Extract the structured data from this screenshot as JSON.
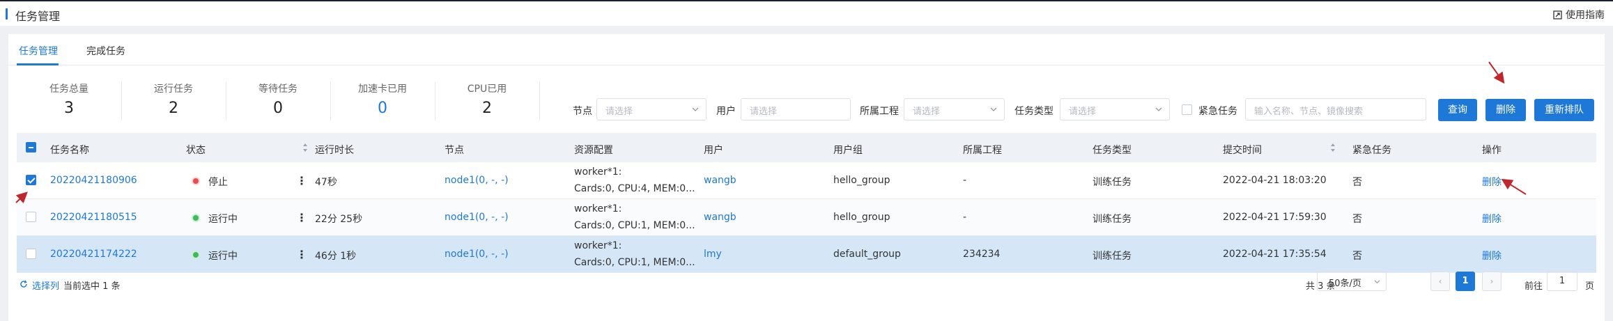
{
  "header": {
    "title": "任务管理",
    "guide_label": "使用指南",
    "guide_icon": "guide-icon"
  },
  "tabs": [
    {
      "label": "任务管理",
      "active": true
    },
    {
      "label": "完成任务",
      "active": false
    }
  ],
  "stats": [
    {
      "label": "任务总量",
      "value": "3"
    },
    {
      "label": "运行任务",
      "value": "2"
    },
    {
      "label": "等待任务",
      "value": "0"
    },
    {
      "label": "加速卡已用",
      "value": "0"
    },
    {
      "label": "CPU已用",
      "value": "2"
    }
  ],
  "filters": {
    "node_label": "节点",
    "node_placeholder": "请选择",
    "user_label": "用户",
    "user_placeholder": "请选择",
    "project_label": "所属工程",
    "project_placeholder": "请选择",
    "type_label": "任务类型",
    "type_placeholder": "请选择",
    "urgent_label": "紧急任务",
    "search_placeholder": "输入名称、节点、镜像搜索"
  },
  "buttons": {
    "query": "查询",
    "delete": "删除",
    "requeue": "重新排队"
  },
  "table": {
    "columns": [
      "任务名称",
      "状态",
      "运行时长",
      "节点",
      "资源配置",
      "用户",
      "用户组",
      "所属工程",
      "任务类型",
      "提交时间",
      "紧急任务",
      "操作"
    ],
    "rows": [
      {
        "name": "20220421180906",
        "status": "停止",
        "duration": "47秒",
        "node": "node1(0, -, -)",
        "res_line1": "worker*1:",
        "res_line2": "Cards:0, CPU:4, MEM:0...",
        "user": "wangb",
        "group": "hello_group",
        "project": "-",
        "type": "训练任务",
        "submitted": "2022-04-21 18:03:20",
        "urgent": "否",
        "action": "删除",
        "checked": true
      },
      {
        "name": "20220421180515",
        "status": "运行中",
        "duration": "22分 25秒",
        "node": "node1(0, -, -)",
        "res_line1": "worker*1:",
        "res_line2": "Cards:0, CPU:1, MEM:0...",
        "user": "wangb",
        "group": "hello_group",
        "project": "-",
        "type": "训练任务",
        "submitted": "2022-04-21 17:59:30",
        "urgent": "否",
        "action": "删除",
        "checked": false
      },
      {
        "name": "20220421174222",
        "status": "运行中",
        "duration": "46分 1秒",
        "node": "node1(0, -, -)",
        "res_line1": "worker*1:",
        "res_line2": "Cards:0, CPU:1, MEM:0...",
        "user": "lmy",
        "group": "default_group",
        "project": "234234",
        "type": "训练任务",
        "submitted": "2022-04-21 17:35:54",
        "urgent": "否",
        "action": "删除",
        "checked": false
      }
    ]
  },
  "footer": {
    "select_columns": "选择列",
    "selected_info": "当前选中 1 条",
    "total": "共 3 条",
    "page_size": "50条/页",
    "current_page": "1",
    "goto_prefix": "前往",
    "goto_value": "1",
    "goto_suffix": "页"
  },
  "colors": {
    "accent": "#1e78d7",
    "stopped": "#e84e4e",
    "running": "#3cbb5a",
    "highlight_row": "#d5e7f6",
    "annotation_arrow": "#c0262d"
  }
}
